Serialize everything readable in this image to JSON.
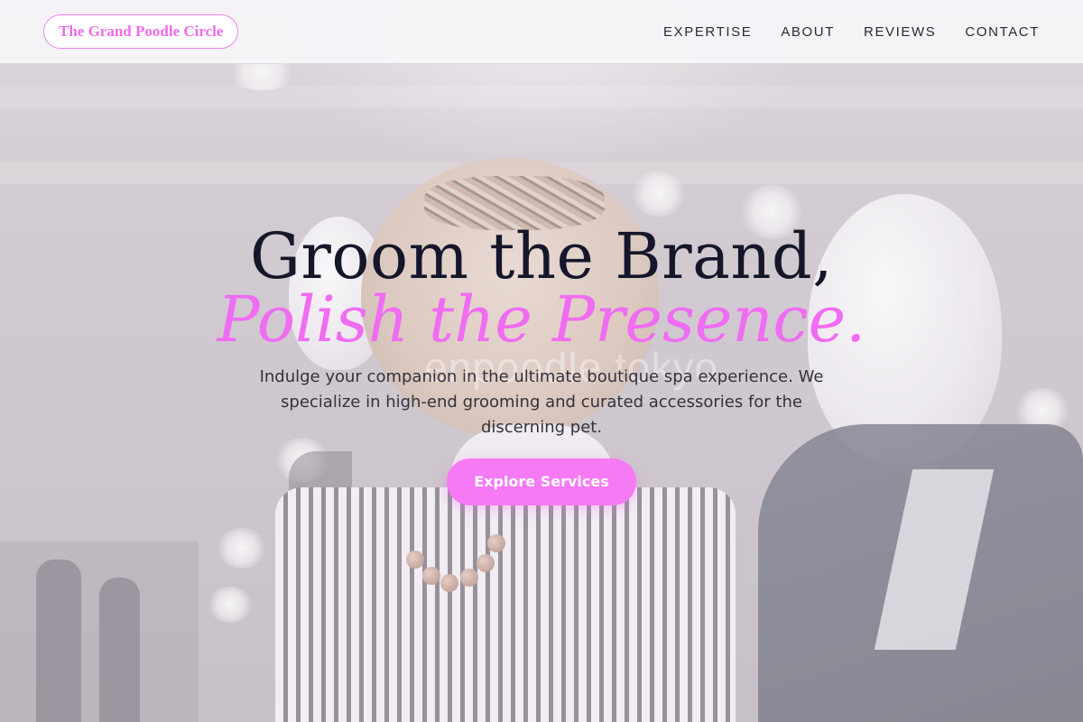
{
  "brand": {
    "name": "The Grand Poodle Circle",
    "accent_color": "#f06cf2"
  },
  "nav": {
    "items": [
      {
        "label": "EXPERTISE"
      },
      {
        "label": "ABOUT"
      },
      {
        "label": "REVIEWS"
      },
      {
        "label": "CONTACT"
      }
    ]
  },
  "hero": {
    "headline_line1": "Groom the Brand,",
    "headline_line2": "Polish the Presence.",
    "subtext": "Indulge your companion in the ultimate boutique spa experience. We specialize in high-end grooming and curated accessories for the discerning pet.",
    "cta_label": "Explore Services",
    "background_sign_text": "enpoodle tokyo"
  }
}
